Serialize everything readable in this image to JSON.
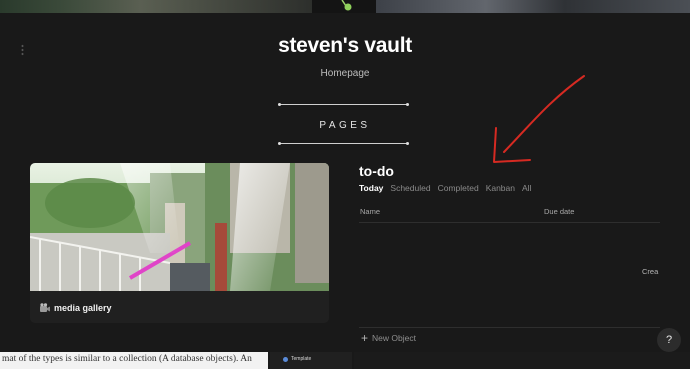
{
  "vault": {
    "title": "steven's vault",
    "subtitle": "Homepage"
  },
  "section": {
    "label": "PAGES"
  },
  "gallery_card": {
    "label": "media gallery",
    "icon": "film-camera-icon"
  },
  "todo": {
    "title": "to-do",
    "tabs": [
      {
        "label": "Today",
        "active": true
      },
      {
        "label": "Scheduled",
        "active": false
      },
      {
        "label": "Completed",
        "active": false
      },
      {
        "label": "Kanban",
        "active": false
      },
      {
        "label": "All",
        "active": false
      }
    ],
    "columns": {
      "name": "Name",
      "due_date": "Due date"
    },
    "truncated_cell": "Crea",
    "new_object_label": "New Object"
  },
  "help": {
    "label": "?"
  },
  "background_doc": {
    "text": "mat of the types is similar to a collection (A database objects). An",
    "template_label": "Template"
  },
  "colors": {
    "background": "#191919",
    "annotation_arrow": "#d62a22",
    "active_tab": "#ffffff",
    "inactive_tab": "#8a8a8a"
  }
}
